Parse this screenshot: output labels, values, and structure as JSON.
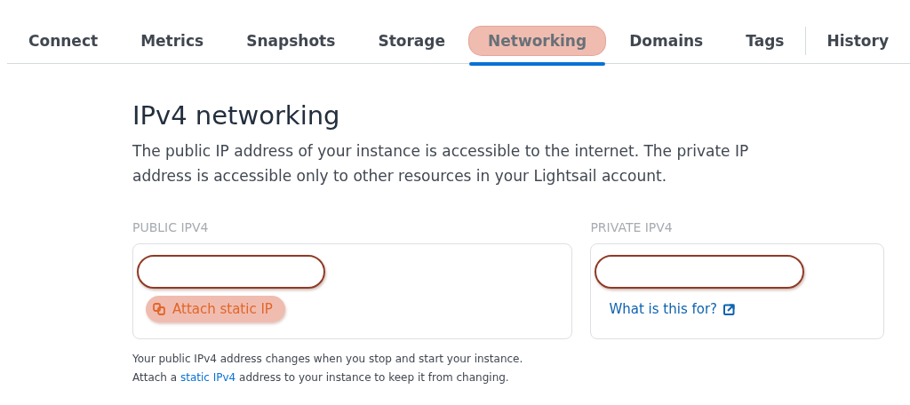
{
  "tabs": [
    {
      "label": "Connect",
      "selected": false,
      "highlighted": false
    },
    {
      "label": "Metrics",
      "selected": false,
      "highlighted": false
    },
    {
      "label": "Snapshots",
      "selected": false,
      "highlighted": false
    },
    {
      "label": "Storage",
      "selected": false,
      "highlighted": false
    },
    {
      "label": "Networking",
      "selected": true,
      "highlighted": true
    },
    {
      "label": "Domains",
      "selected": false,
      "highlighted": false
    },
    {
      "label": "Tags",
      "selected": false,
      "highlighted": false
    },
    {
      "label": "History",
      "selected": false,
      "highlighted": false
    }
  ],
  "section": {
    "title": "IPv4 networking",
    "description": "The public IP address of your instance is accessible to the internet. The private IP address is accessible only to other resources in your Lightsail account."
  },
  "public_ipv4": {
    "label": "PUBLIC IPV4",
    "address_redacted": true,
    "button": {
      "label": "Attach static IP",
      "highlighted": true
    }
  },
  "private_ipv4": {
    "label": "PRIVATE IPV4",
    "address_redacted": true,
    "link": "What is this for?"
  },
  "footnote": {
    "line_1": "Your public IPv4 address changes when you stop and start your instance.",
    "line_2_before": "Attach a",
    "line_2_link": "static IPv4",
    "line_2_after": "address to your instance to keep it from changing."
  }
}
